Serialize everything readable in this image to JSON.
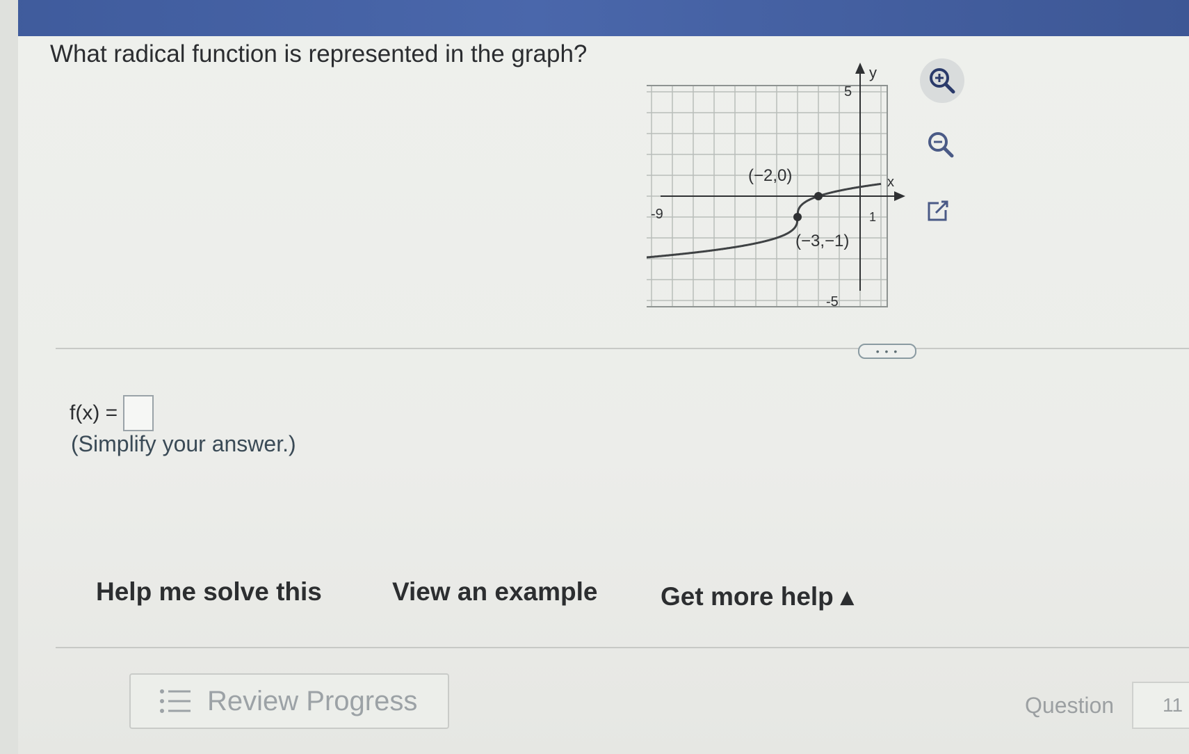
{
  "question": {
    "text": "What radical function is represented in the graph?"
  },
  "graph": {
    "y_axis_label": "y",
    "x_axis_label": "x",
    "tick_y_top": "5",
    "tick_y_bottom": "-5",
    "tick_x_left": "-9",
    "tick_x_right": "1",
    "point_a_label": "(−2,0)",
    "point_b_label": "(−3,−1)",
    "point_a": [
      -2,
      0
    ],
    "point_b": [
      -3,
      -1
    ],
    "grid": true
  },
  "tools": {
    "zoom_in_icon": "zoom-in-icon",
    "zoom_out_icon": "zoom-out-icon",
    "popout_icon": "external-link-icon"
  },
  "more": {
    "label": "• • •"
  },
  "answer": {
    "prefix": "f(x) =",
    "value": "",
    "hint": "(Simplify your answer.)"
  },
  "help": {
    "solve": "Help me solve this",
    "example": "View an example",
    "more_help": "Get more help ▴"
  },
  "footer": {
    "review_label": "Review Progress",
    "question_label": "Question",
    "question_number": "11"
  },
  "colors": {
    "topbar": "#4a67ab",
    "curve": "#3f4244"
  }
}
